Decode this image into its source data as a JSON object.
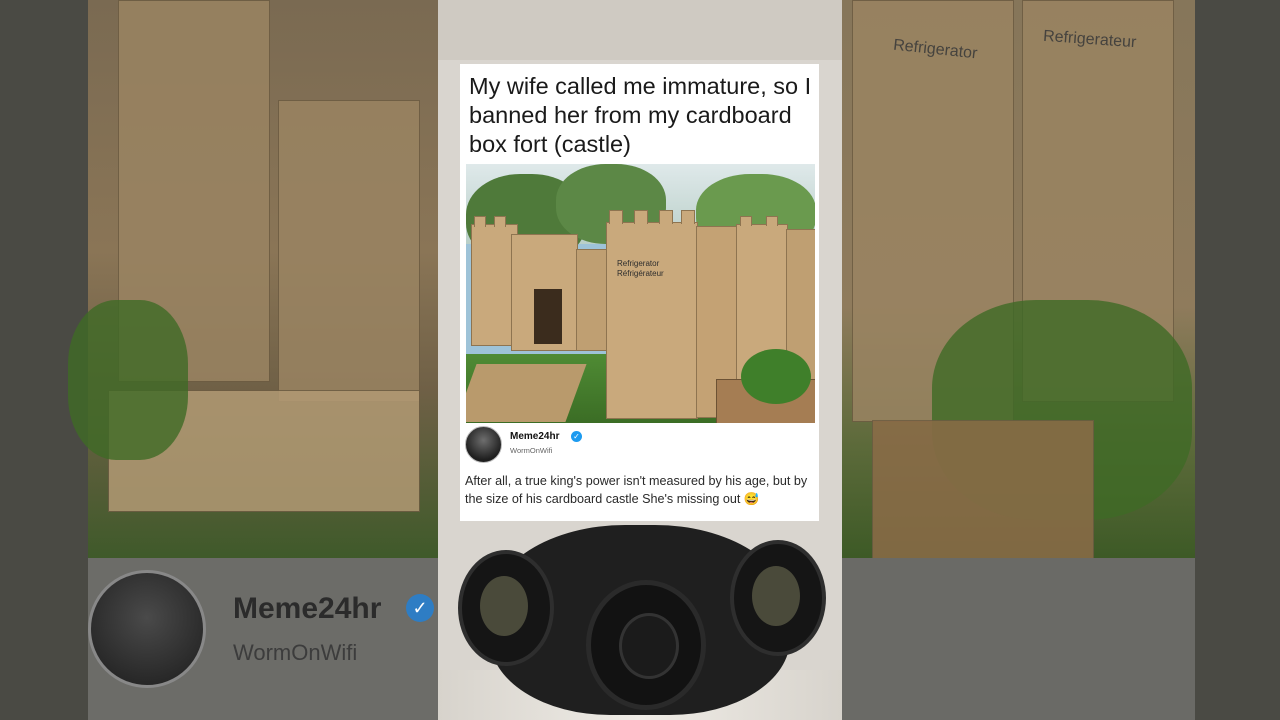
{
  "meme": {
    "caption": "My wife called me immature, so I banned her from my cardboard box fort (castle)",
    "image_labels": {
      "refrigerator": "Refrigerator",
      "refrigerateur": "Réfrigérateur"
    },
    "author": {
      "name": "Meme24hr",
      "handle": "WormOnWifi",
      "verified": true
    },
    "text": "After all, a true king's power isn't measured by his age, but by the size of his cardboard castle She's missing out 😅"
  },
  "background_profile": {
    "name": "Meme24hr",
    "handle": "WormOnWifi"
  },
  "background_labels": {
    "refrigerator": "Refrigerator",
    "refrigerateur": "Refrigerateur"
  },
  "colors": {
    "verified_badge": "#1d9bf0",
    "card_background": "#ffffff",
    "cardboard": "#c9a97c",
    "grass": "#4f8b34"
  },
  "icons": {
    "verified": "verified-badge-icon"
  }
}
